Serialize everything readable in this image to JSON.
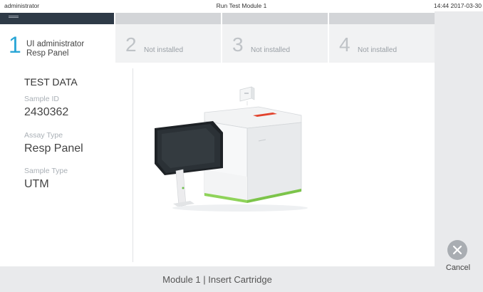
{
  "topbar": {
    "user": "administrator",
    "title": "Run Test Module 1",
    "clock": "14:44 2017-03-30"
  },
  "tabs": [
    {
      "number": "1",
      "line1": "UI administrator",
      "line2": "Resp Panel"
    },
    {
      "number": "2",
      "label": "Not installed"
    },
    {
      "number": "3",
      "label": "Not installed"
    },
    {
      "number": "4",
      "label": "Not installed"
    }
  ],
  "test_data": {
    "title": "TEST DATA",
    "sample_id_label": "Sample ID",
    "sample_id": "2430362",
    "assay_type_label": "Assay Type",
    "assay_type": "Resp Panel",
    "sample_type_label": "Sample Type",
    "sample_type": "UTM"
  },
  "footer": {
    "status": "Module 1  |  Insert Cartridge"
  },
  "actions": {
    "cancel_label": "Cancel"
  },
  "icons": {
    "cancel": "close-icon",
    "illustration": "analyzer-device-illustration"
  },
  "colors": {
    "accent": "#2aa6d6",
    "active_strip": "#2e3a47",
    "inactive_strip": "#d3d5d8",
    "cancel_button": "#a9adb2"
  }
}
